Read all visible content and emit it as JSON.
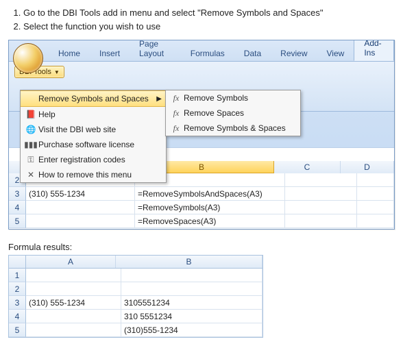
{
  "instructions": {
    "step1": "Go to the DBI Tools add in menu and select \"Remove Symbols and Spaces\"",
    "step2": "Select the function you wish to use"
  },
  "tabs": {
    "home": "Home",
    "insert": "Insert",
    "pagelayout": "Page Layout",
    "formulas": "Formulas",
    "data": "Data",
    "review": "Review",
    "view": "View",
    "addins": "Add-Ins"
  },
  "ribbon": {
    "dbi_label": "DBI Tools"
  },
  "menu": {
    "remove": "Remove Symbols and Spaces",
    "help": "Help",
    "visit": "Visit the DBI web site",
    "purchase": "Purchase software license",
    "enter": "Enter registration codes",
    "howto": "How to remove this menu"
  },
  "submenu": {
    "rs": "Remove Symbols",
    "rsp": "Remove Spaces",
    "rss": "Remove Symbols & Spaces"
  },
  "columns": {
    "A": "A",
    "B": "B",
    "C": "C",
    "D": "D"
  },
  "rows_top": {
    "r2": "2",
    "r3": "3",
    "r4": "4",
    "r5": "5"
  },
  "grid_top": {
    "a3": "(310) 555-1234",
    "b3": "=RemoveSymbolsAndSpaces(A3)",
    "b4": "=RemoveSymbols(A3)",
    "b5": "=RemoveSpaces(A3)"
  },
  "results_label": "Formula results:",
  "rows_bot": {
    "r1": "1",
    "r2": "2",
    "r3": "3",
    "r4": "4",
    "r5": "5"
  },
  "grid_bot": {
    "a3": "(310) 555-1234",
    "b3": "3105551234",
    "b4": "310 5551234",
    "b5": "(310)555-1234"
  },
  "chart_data": {
    "type": "table",
    "title": "Formula results",
    "columns": [
      "A",
      "B"
    ],
    "rows": [
      {
        "A": "(310) 555-1234",
        "B": "3105551234"
      },
      {
        "A": "",
        "B": "310 5551234"
      },
      {
        "A": "",
        "B": "(310)555-1234"
      }
    ]
  }
}
